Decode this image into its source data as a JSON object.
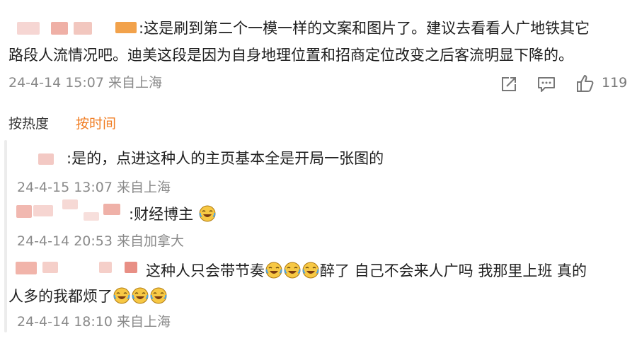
{
  "main_comment": {
    "line1": ":这是刷到第二个一模一样的文案和图片了。建议去看看人广地铁其它",
    "line2": "路段人流情况吧。迪美这段是因为自身地理位置和招商定位改变之后客流明显下降的。",
    "timestamp": "24-4-14 15:07 来自上海",
    "like_count": "119",
    "share_icon": "share-icon",
    "comment_icon": "comment-icon",
    "like_icon": "like-icon"
  },
  "sort": {
    "by_heat": "按热度",
    "by_time": "按时间",
    "active_color": "#f07d23"
  },
  "replies": [
    {
      "text": ":是的，点进这种人的主页基本全是开局一张图的",
      "timestamp": "24-4-15 13:07 来自上海"
    },
    {
      "text": ":财经博主",
      "emoji": [
        "laugh-cry-icon"
      ],
      "timestamp": "24-4-14 20:53 来自加拿大"
    },
    {
      "text_part1": "这种人只会带节奏",
      "emoji_mid": [
        "laugh-cry-icon",
        "laugh-cry-icon",
        "laugh-cry-icon"
      ],
      "text_part2": "醉了 自己不会来人广吗 我那里上班 真的",
      "line2": "人多的我都烦了",
      "emoji_end": [
        "laugh-cry-icon",
        "laugh-cry-icon",
        "laugh-cry-icon"
      ],
      "timestamp": "24-4-14 18:10 来自上海"
    }
  ]
}
